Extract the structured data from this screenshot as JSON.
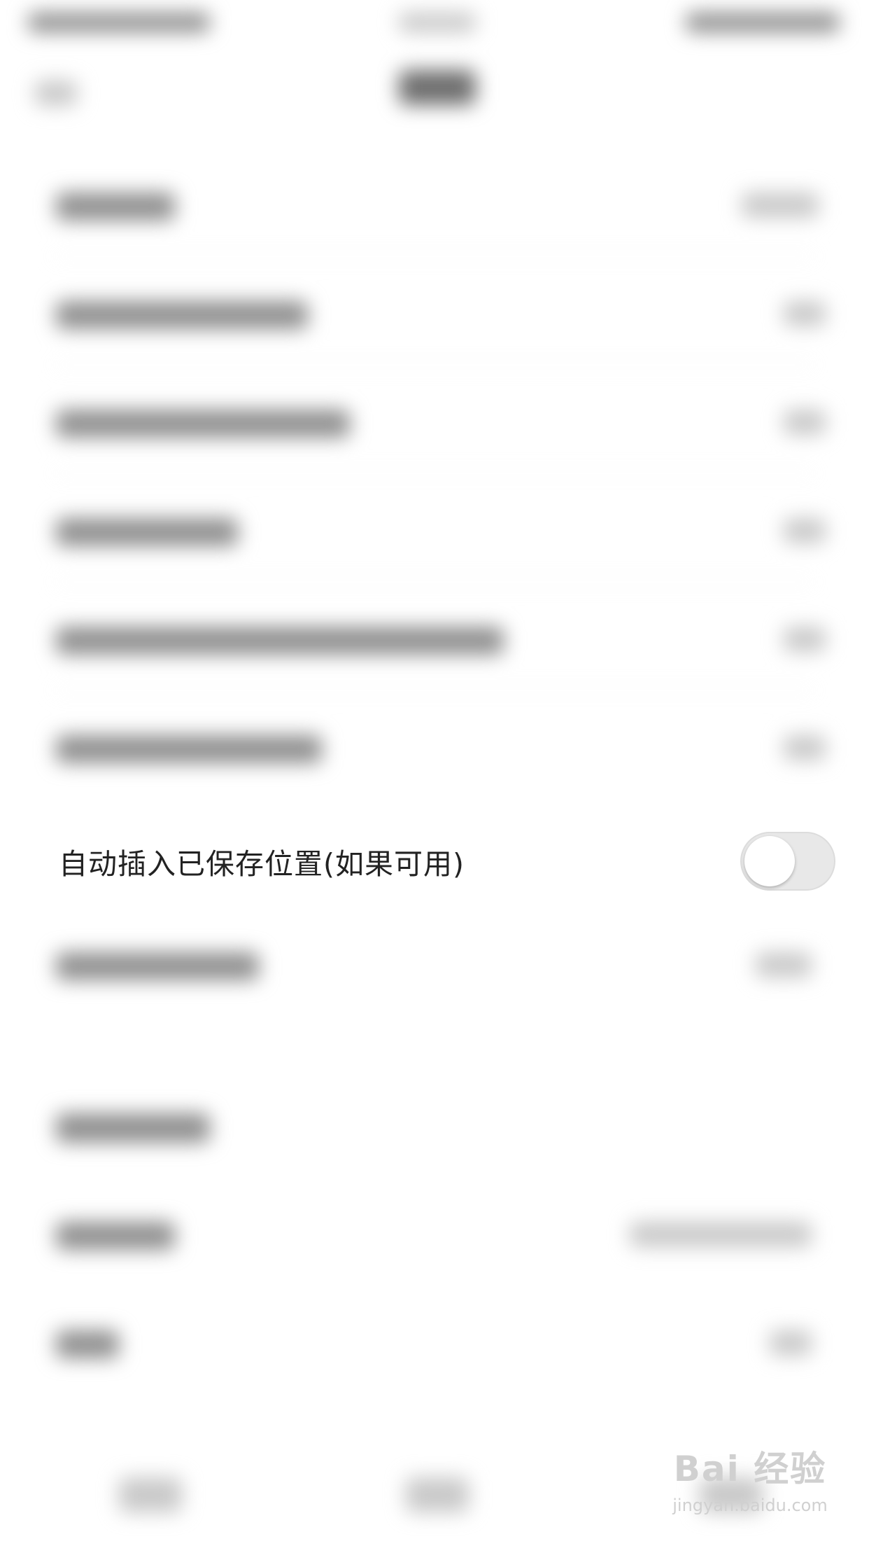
{
  "setting": {
    "label": "自动插入已保存位置(如果可用)",
    "enabled": false
  },
  "watermark": {
    "logo": "Bai 经验",
    "url": "jingyan.baidu.com"
  }
}
